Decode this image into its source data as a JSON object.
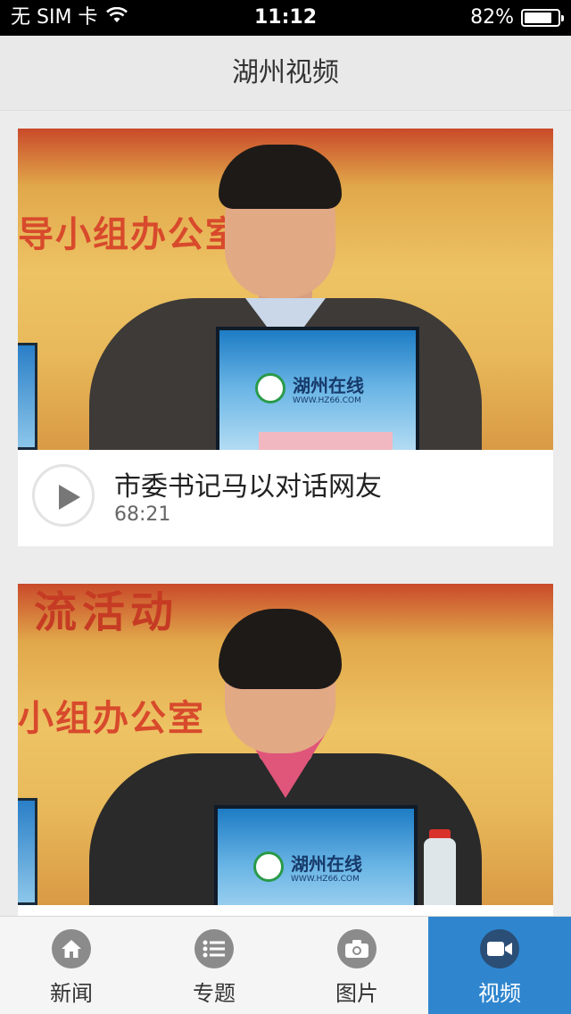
{
  "status_bar": {
    "carrier": "无 SIM 卡",
    "time": "11:12",
    "battery": "82%",
    "battery_level": 0.82
  },
  "nav": {
    "title": "湖州视频"
  },
  "videos": [
    {
      "title": "市委书记马以对话网友",
      "duration": "68:21",
      "banner": "导小组办公室",
      "monitor_brand": "湖州在线",
      "monitor_url": "WWW.HZ66.COM"
    },
    {
      "title": "",
      "duration": "",
      "banner": "小组办公室",
      "banner_top": "流活动",
      "monitor_brand": "湖州在线",
      "monitor_url": "WWW.HZ66.COM"
    }
  ],
  "tabs": [
    {
      "label": "新闻",
      "icon": "home-icon",
      "active": false
    },
    {
      "label": "专题",
      "icon": "list-icon",
      "active": false
    },
    {
      "label": "图片",
      "icon": "camera-icon",
      "active": false
    },
    {
      "label": "视频",
      "icon": "video-camera-icon",
      "active": true
    }
  ],
  "colors": {
    "accent": "#2f86cf",
    "nav_background": "#e9e9e9",
    "page_background": "#ececec"
  }
}
